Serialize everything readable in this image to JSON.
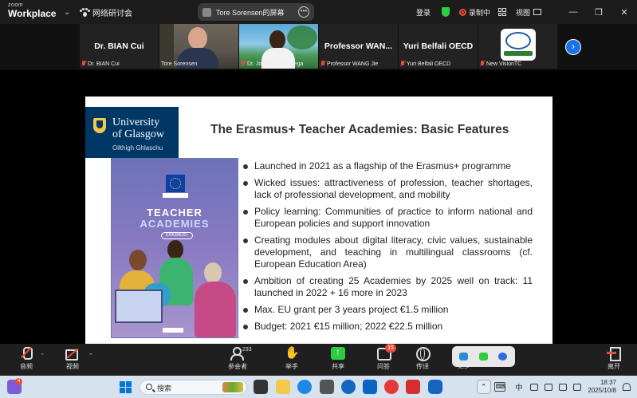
{
  "app": {
    "brand_top": "zoom",
    "brand_bottom": "Workplace"
  },
  "topbar": {
    "meeting_name": "网络研讨会",
    "sharing_label": "Tore Sorensen的屏幕",
    "login": "登录",
    "recording": "录制中",
    "view": "视图"
  },
  "participants": [
    {
      "big": "Dr. BIAN Cui",
      "cap": "Dr. BIAN Cui"
    },
    {
      "big": "",
      "cap": "Tore Sorensen"
    },
    {
      "big": "",
      "cap": "Dr. Joseph Agbenyega"
    },
    {
      "big": "Professor  WAN...",
      "cap": "Professor WANG Jie"
    },
    {
      "big": "Yuri Belfali OECD",
      "cap": "Yuri Belfali OECD"
    },
    {
      "big": "",
      "cap": "New VisionTC"
    }
  ],
  "slide": {
    "university_line1": "University",
    "university_line2": "of Glasgow",
    "university_gaelic": "Oilthigh Ghlaschu",
    "title": "The Erasmus+ Teacher Academies: Basic Features",
    "book_title1": "TEACHER",
    "book_title2": "ACADEMIES",
    "book_tag": "ERASMUS+",
    "bullets": [
      "Launched in 2021 as a flagship of the Erasmus+ programme",
      "Wicked issues: attractiveness of profession, teacher shortages, lack of professional development, and mobility",
      "Policy learning: Communities of practice to inform national and European policies and support innovation",
      "Creating modules about digital literacy, civic values, sustainable development, and teaching in multilingual classrooms (cf. European Education Area)",
      "Ambition of creating 25 Academies by 2025 well on track: 11 launched in 2022 + 16 more in 2023",
      "Max. EU grant per 3 years project €1.5 million",
      "Budget: 2021 €15 million; 2022 €22.5 million"
    ]
  },
  "controls": {
    "audio": "音频",
    "video": "视频",
    "participants": "参会者",
    "participants_count": "233",
    "raise_hand": "举手",
    "share": "共享",
    "qa": "问答",
    "qa_badge": "15",
    "interpret": "传译",
    "more": "更多",
    "leave": "离开"
  },
  "taskbar": {
    "search_placeholder": "搜索",
    "widget_badge": "4",
    "ime": "中",
    "time": "18:37",
    "date": "2025/10/8"
  },
  "colors": {
    "accent": "#1a73e8",
    "recording": "#e74c3c",
    "active_speaker": "#2ecc71",
    "uog_blue": "#003865"
  }
}
